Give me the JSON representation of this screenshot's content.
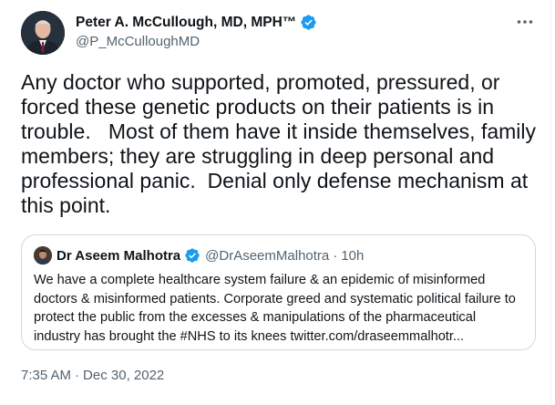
{
  "author": {
    "name": "Peter A. McCullough, MD, MPH™",
    "handle": "@P_McCulloughMD",
    "verified_color": "#1d9bf0"
  },
  "tweet": {
    "text": "Any doctor who supported, promoted, pressured, or forced these genetic products on their patients is in trouble.   Most of them have it inside themselves, family members; they are struggling in deep personal and professional panic.  Denial only defense mechanism at this point."
  },
  "quote": {
    "name": "Dr Aseem Malhotra",
    "handle": "@DrAseemMalhotra",
    "separator": "·",
    "time": "10h",
    "text": "We have a complete healthcare system failure & an epidemic of misinformed doctors & misinformed patients. Corporate greed and systematic political failure to protect the public from the excesses & manipulations of the pharmaceutical industry has brought the #NHS to its knees twitter.com/draseemmalhotr..."
  },
  "footer": {
    "time": "7:35 AM",
    "separator": "·",
    "date": "Dec 30, 2022"
  },
  "icons": {
    "verified": "verified-badge-icon",
    "more": "more-horizontal-icon"
  }
}
